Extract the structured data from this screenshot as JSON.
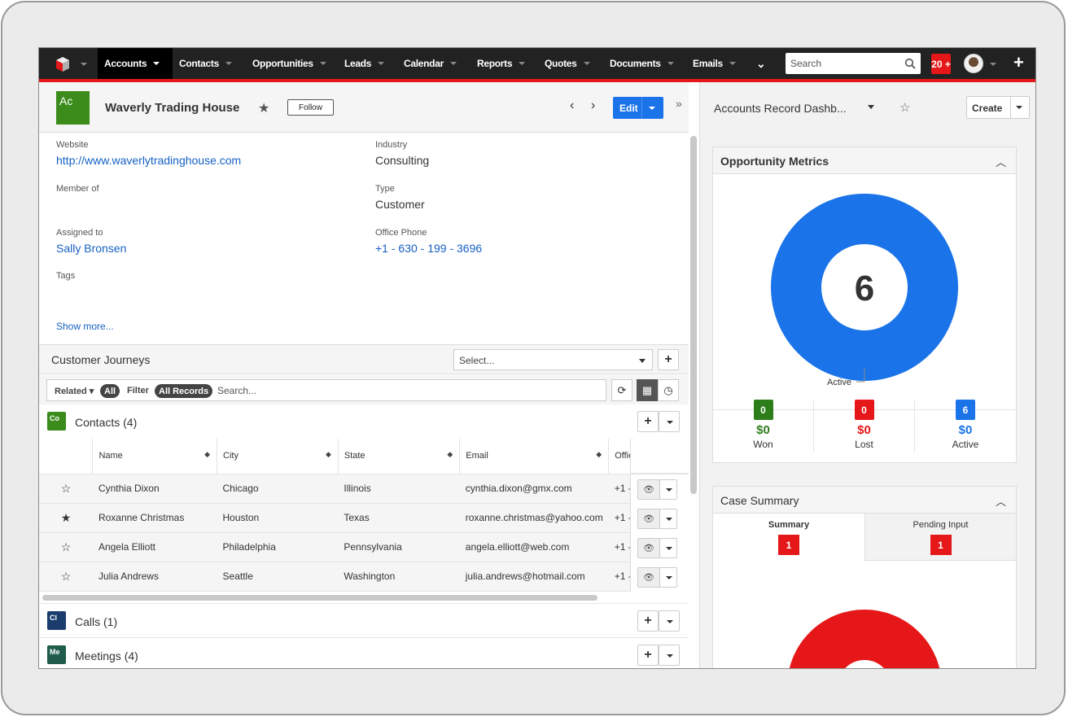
{
  "nav": {
    "items": [
      {
        "label": "Accounts"
      },
      {
        "label": "Contacts"
      },
      {
        "label": "Opportunities"
      },
      {
        "label": "Leads"
      },
      {
        "label": "Calendar"
      },
      {
        "label": "Reports"
      },
      {
        "label": "Quotes"
      },
      {
        "label": "Documents"
      },
      {
        "label": "Emails"
      }
    ],
    "search_placeholder": "Search",
    "notification_count": "20 +",
    "colors": {
      "bar": "#222222",
      "accent": "#e61718"
    }
  },
  "record": {
    "badge": "Ac",
    "name": "Waverly Trading House",
    "follow_label": "Follow",
    "edit_label": "Edit",
    "fields": {
      "website_label": "Website",
      "website_value": "http://www.waverlytradinghouse.com",
      "industry_label": "Industry",
      "industry_value": "Consulting",
      "member_label": "Member of",
      "type_label": "Type",
      "type_value": "Customer",
      "assigned_label": "Assigned to",
      "assigned_value": "Sally Bronsen",
      "phone_label": "Office Phone",
      "phone_value": "+1 - 630 - 199 - 3696",
      "tags_label": "Tags"
    },
    "show_more": "Show more..."
  },
  "journeys": {
    "title": "Customer Journeys",
    "select_placeholder": "Select..."
  },
  "filter": {
    "related_label": "Related",
    "all_pill": "All",
    "filter_label": "Filter",
    "records_pill": "All Records",
    "search_placeholder": "Search..."
  },
  "subpanels": {
    "contacts": {
      "icon": "Co",
      "title": "Contacts (4)",
      "color": "#3b8c1b"
    },
    "calls": {
      "icon": "Cl",
      "title": "Calls (1)",
      "color": "#1b3d6d"
    },
    "meetings": {
      "icon": "Me",
      "title": "Meetings (4)",
      "color": "#1f5c4a"
    }
  },
  "contacts_table": {
    "headers": {
      "name": "Name",
      "city": "City",
      "state": "State",
      "email": "Email",
      "office": "Offic"
    },
    "rows": [
      {
        "star": "☆",
        "name": "Cynthia Dixon",
        "city": "Chicago",
        "state": "Illinois",
        "email": "cynthia.dixon@gmx.com",
        "phone": "+1 -"
      },
      {
        "star": "★",
        "name": "Roxanne Christmas",
        "city": "Houston",
        "state": "Texas",
        "email": "roxanne.christmas@yahoo.com",
        "phone": "+1 -"
      },
      {
        "star": "☆",
        "name": "Angela Elliott",
        "city": "Philadelphia",
        "state": "Pennsylvania",
        "email": "angela.elliott@web.com",
        "phone": "+1 -"
      },
      {
        "star": "☆",
        "name": "Julia Andrews",
        "city": "Seattle",
        "state": "Washington",
        "email": "julia.andrews@hotmail.com",
        "phone": "+1 -"
      }
    ]
  },
  "dashboard": {
    "title": "Accounts Record Dashb...",
    "create_label": "Create",
    "opportunity": {
      "title": "Opportunity Metrics",
      "center_value": "6",
      "legend_label": "Active",
      "metrics": [
        {
          "count": "0",
          "amount": "$0",
          "label": "Won",
          "color": "#2d7d1a"
        },
        {
          "count": "0",
          "amount": "$0",
          "label": "Lost",
          "color": "#e61718"
        },
        {
          "count": "6",
          "amount": "$0",
          "label": "Active",
          "color": "#1a73e8"
        }
      ],
      "donut_color": "#1a73e8"
    },
    "case_summary": {
      "title": "Case Summary",
      "tabs": [
        {
          "label": "Summary",
          "count": "1"
        },
        {
          "label": "Pending Input",
          "count": "1"
        }
      ],
      "donut_color": "#e61718"
    }
  }
}
